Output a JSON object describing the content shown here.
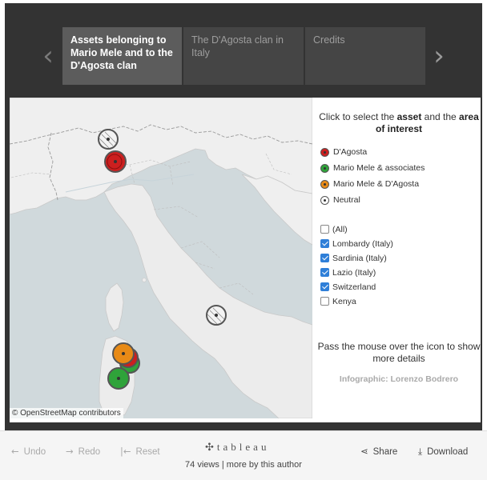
{
  "story": {
    "tabs": [
      {
        "label": "Assets belonging to Mario Mele and to the D'Agosta clan",
        "active": true
      },
      {
        "label": "The D'Agosta clan in Italy",
        "active": false
      },
      {
        "label": "Credits",
        "active": false
      }
    ],
    "prev_icon": "chevron-left-icon",
    "next_icon": "chevron-right-icon"
  },
  "map": {
    "attribution": "© OpenStreetMap contributors"
  },
  "panel": {
    "instruction_prefix": "Click to select the ",
    "instruction_asset": "asset",
    "instruction_mid": " and the ",
    "instruction_area": "area of interest",
    "legend": [
      {
        "label": "D'Agosta",
        "color": "#cc1f1f"
      },
      {
        "label": "Mario Mele & associates",
        "color": "#2fa33a"
      },
      {
        "label": "Mario Mele & D'Agosta",
        "color": "#e88a16"
      },
      {
        "label": "Neutral",
        "color": "#ffffff"
      }
    ],
    "filters": [
      {
        "label": "(All)",
        "checked": false
      },
      {
        "label": "Lombardy (Italy)",
        "checked": true
      },
      {
        "label": "Sardinia (Italy)",
        "checked": true
      },
      {
        "label": "Lazio (Italy)",
        "checked": true
      },
      {
        "label": "Switzerland",
        "checked": true
      },
      {
        "label": "Kenya",
        "checked": false
      }
    ],
    "hover_note": "Pass the mouse over the icon to show more details",
    "credit": "Infographic: Lorenzo Bodrero"
  },
  "toolbar": {
    "undo": "Undo",
    "redo": "Redo",
    "reset": "Reset",
    "brand": "tableau",
    "views": "74 views | more by this author",
    "share": "Share",
    "download": "Download",
    "icons": {
      "undo": "undo-arrow-icon",
      "redo": "redo-arrow-icon",
      "reset": "reset-icon",
      "share": "share-icon",
      "download": "download-icon",
      "brand": "tableau-logo-icon"
    }
  }
}
